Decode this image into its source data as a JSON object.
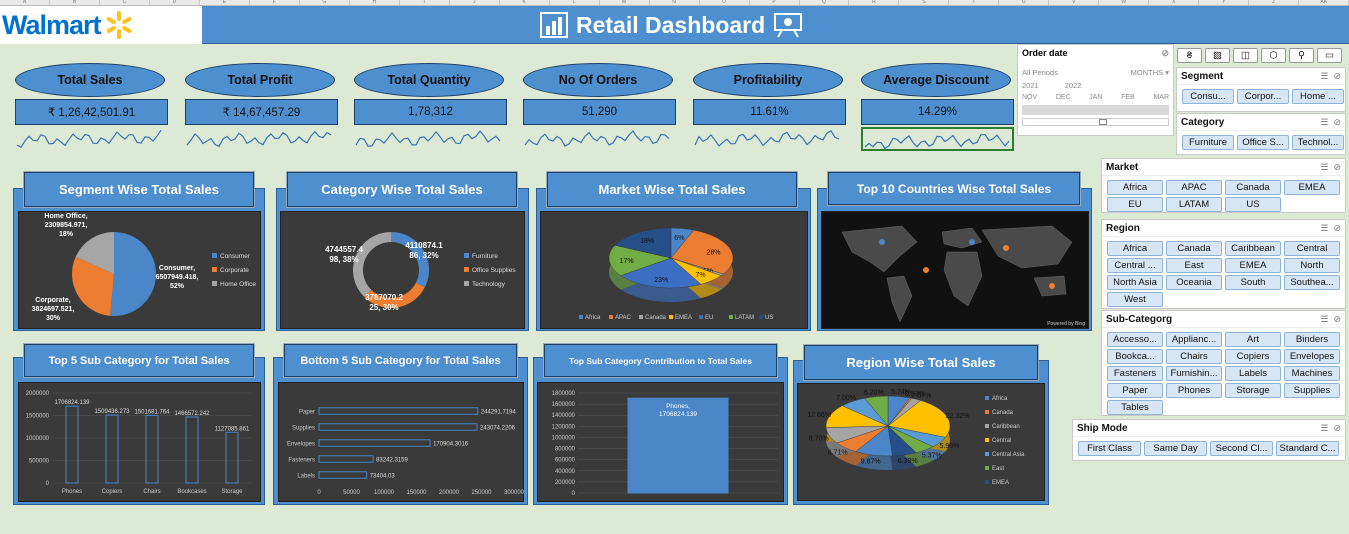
{
  "header": {
    "brand": "Walmart",
    "title": "Retail Dashboard"
  },
  "sheet_columns": [
    "A",
    "B",
    "C",
    "D",
    "E",
    "F",
    "G",
    "H",
    "I",
    "J",
    "K",
    "L",
    "M",
    "N",
    "O",
    "P",
    "Q",
    "R",
    "S",
    "T",
    "U",
    "V",
    "W",
    "X",
    "Y",
    "Z",
    "AA"
  ],
  "kpis": [
    {
      "label": "Total Sales",
      "value": "₹ 1,26,42,501.91"
    },
    {
      "label": "Total Profit",
      "value": "₹ 14,67,457.29"
    },
    {
      "label": "Total Quantity",
      "value": "1,78,312"
    },
    {
      "label": "No Of Orders",
      "value": "51,290"
    },
    {
      "label": "Profitability",
      "value": "11.61%"
    },
    {
      "label": "Average Discount",
      "value": "14.29%"
    }
  ],
  "timeline": {
    "title": "Order date",
    "period": "All Periods",
    "unit": "MONTHS",
    "years": [
      "2021",
      "2022"
    ],
    "months": [
      "NOV",
      "DEC",
      "JAN",
      "FEB",
      "MAR"
    ]
  },
  "slicers": {
    "segment": {
      "title": "Segment",
      "items": [
        "Consu...",
        "Corpor...",
        "Home ..."
      ]
    },
    "category": {
      "title": "Category",
      "items": [
        "Furniture",
        "Office S...",
        "Technol..."
      ]
    },
    "market": {
      "title": "Market",
      "items": [
        "Africa",
        "APAC",
        "Canada",
        "EMEA",
        "EU",
        "LATAM",
        "US"
      ]
    },
    "region": {
      "title": "Region",
      "items": [
        "Africa",
        "Canada",
        "Caribbean",
        "Central",
        "Central ...",
        "East",
        "EMEA",
        "North",
        "North Asia",
        "Oceania",
        "South",
        "Southea...",
        "West"
      ]
    },
    "subcategory": {
      "title": "Sub-Categorg",
      "items": [
        "Accesso...",
        "Applianc...",
        "Art",
        "Binders",
        "Bookca...",
        "Chairs",
        "Copiers",
        "Envelopes",
        "Fasteners",
        "Furnishin...",
        "Labels",
        "Machines",
        "Paper",
        "Phones",
        "Storage",
        "Supplies",
        "Tables"
      ]
    },
    "shipmode": {
      "title": "Ship Mode",
      "items": [
        "First Class",
        "Same Day",
        "Second Cl...",
        "Standard C..."
      ]
    }
  },
  "panels": {
    "segment": "Segment Wise Total Sales",
    "category": "Category Wise Total Sales",
    "market": "Market Wise Total Sales",
    "countries": "Top 10 Countries Wise Total Sales",
    "top5": "Top 5 Sub Category for Total Sales",
    "bottom5": "Bottom 5 Sub Category for Total Sales",
    "topsub": "Top Sub Category Contribution to Total Sales",
    "region": "Region Wise Total Sales"
  },
  "map_credit": "Powered by Bing",
  "chart_data": [
    {
      "type": "pie",
      "title": "Segment Wise Total Sales",
      "categories": [
        "Consumer",
        "Corporate",
        "Home Office"
      ],
      "values": [
        6507949.418,
        3824697.521,
        2309854.971
      ],
      "labels": [
        "Consumer, 6507949.418, 52%",
        "Corporate, 3824697.521, 30%",
        "Home Office, 2309854.971, 18%"
      ],
      "colors": [
        "#4a86c8",
        "#ed7d31",
        "#a5a5a5"
      ],
      "legend": "right"
    },
    {
      "type": "pie",
      "variant": "doughnut",
      "title": "Category Wise Total Sales",
      "categories": [
        "Furniture",
        "Office Supplies",
        "Technology"
      ],
      "values": [
        4110874.186,
        3787070.225,
        4744557.498
      ],
      "labels": [
        "4110874.1 86, 32%",
        "3787070.2 25, 30%",
        "4744557.4 98, 38%"
      ],
      "colors": [
        "#4a86c8",
        "#ed7d31",
        "#a5a5a5"
      ],
      "legend": "right"
    },
    {
      "type": "pie",
      "variant": "3d",
      "title": "Market Wise Total Sales",
      "categories": [
        "Africa",
        "APAC",
        "Canada",
        "EMEA",
        "EU",
        "LATAM",
        "US"
      ],
      "values": [
        6,
        28,
        1,
        7,
        23,
        17,
        18
      ],
      "labels": [
        "6%",
        "28%",
        "1%",
        "7%",
        "23%",
        "17%",
        "18%"
      ],
      "colors": [
        "#4a86c8",
        "#ed7d31",
        "#a5a5a5",
        "#ffc000",
        "#3c6fc4",
        "#70ad47",
        "#264f8a"
      ],
      "legend": "bottom"
    },
    {
      "type": "bar",
      "title": "Top 5 Sub Category for Total Sales",
      "categories": [
        "Phones",
        "Copiers",
        "Chairs",
        "Bookcases",
        "Storage"
      ],
      "values": [
        1706824.139,
        1509436.273,
        1501681.764,
        1466572.242,
        1127085.861
      ],
      "ylim": [
        0,
        2000000
      ],
      "yticks": [
        "2000000",
        "1500000",
        "1000000",
        "500000",
        "0"
      ]
    },
    {
      "type": "bar",
      "orientation": "horizontal",
      "title": "Bottom 5 Sub Category for Total Sales",
      "categories": [
        "Paper",
        "Supplies",
        "Envelopes",
        "Fasteners",
        "Labels"
      ],
      "values": [
        244291.7194,
        243074.2206,
        170904.3016,
        83242.3159,
        73404.03
      ],
      "xlim": [
        0,
        300000
      ],
      "xticks": [
        "0",
        "50000",
        "100000",
        "150000",
        "200000",
        "250000",
        "300000"
      ]
    },
    {
      "type": "bar",
      "title": "Top Sub Category Contribution to Total Sales",
      "categories": [
        "Phones"
      ],
      "values": [
        1706824.139
      ],
      "labels": [
        "Phones, 1706824.139"
      ],
      "ylim": [
        0,
        1800000
      ],
      "yticks": [
        "1800000",
        "1600000",
        "1400000",
        "1200000",
        "1000000",
        "800000",
        "600000",
        "400000",
        "200000",
        "0"
      ]
    },
    {
      "type": "pie",
      "variant": "3d",
      "title": "Region Wise Total Sales",
      "categories": [
        "Africa",
        "Canada",
        "Caribbean",
        "Central",
        "Central Asia",
        "East",
        "EMEA"
      ],
      "values": [
        5.74,
        0.53,
        2.57,
        22.32,
        5.95,
        5.37,
        6.38,
        9.87,
        6.71,
        8.7,
        12.66,
        7.0,
        6.2
      ],
      "labels": [
        "5.74%",
        "0.53%",
        "2.57%",
        "22.32%",
        "5.95%",
        "5.37%",
        "6.38%",
        "9.87%",
        "6.71%",
        "8.70%",
        "12.66%",
        "7.00%",
        "6.20%"
      ],
      "colors": [
        "#4a86c8",
        "#ed7d31",
        "#a5a5a5",
        "#ffc000",
        "#5b9bd5",
        "#70ad47",
        "#264f8a"
      ],
      "legend": "right"
    }
  ]
}
